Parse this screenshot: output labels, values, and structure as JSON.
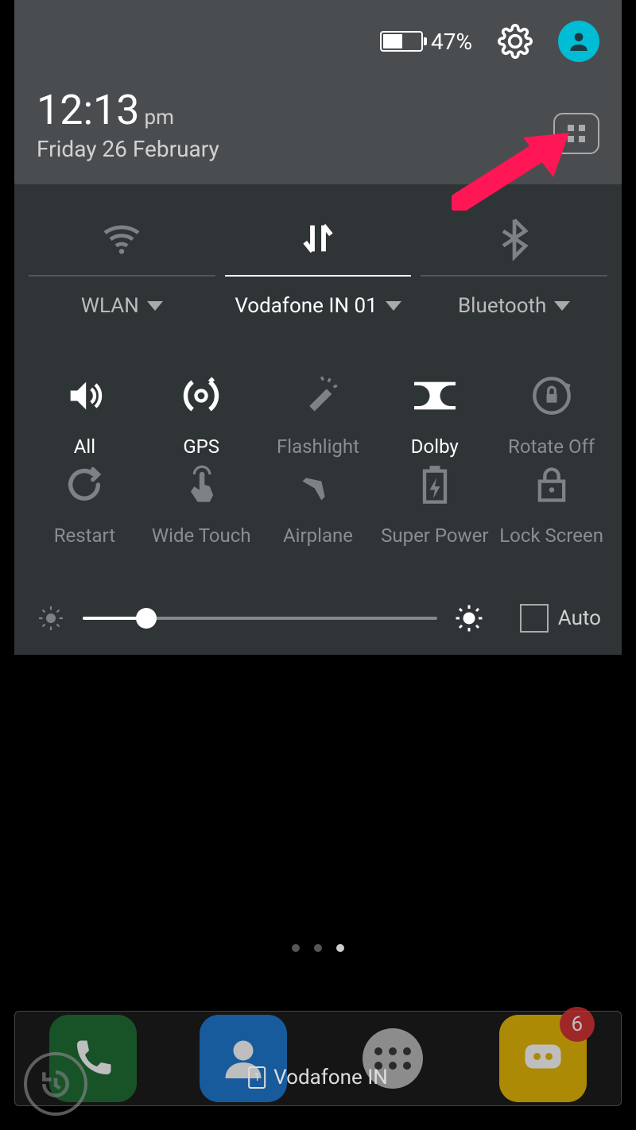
{
  "status": {
    "battery_pct": "47%"
  },
  "clock": {
    "time": "12:13",
    "ampm": "pm",
    "date": "Friday 26 February"
  },
  "conn": {
    "wlan": {
      "label": "WLAN"
    },
    "data": {
      "label": "Vodafone IN 01"
    },
    "bt": {
      "label": "Bluetooth"
    }
  },
  "tiles": {
    "sound": "All",
    "gps": "GPS",
    "flashlight": "Flashlight",
    "dolby": "Dolby",
    "rotate": "Rotate Off",
    "restart": "Restart",
    "widetouch": "Wide Touch",
    "airplane": "Airplane",
    "superpower": "Super Power",
    "lockscreen": "Lock Screen"
  },
  "brightness": {
    "auto_label": "Auto",
    "value_pct": 18
  },
  "dock": {
    "badge_msg": "6",
    "carrier": "Vodafone IN",
    "sim_slot": "1"
  }
}
